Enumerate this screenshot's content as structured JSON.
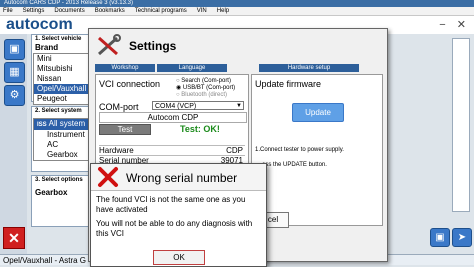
{
  "window": {
    "title": "Autocom CARS CDP - 2013 Release 3 (v3.13.3)",
    "logo": "autocom",
    "min_btn": "−",
    "close_btn": "✕"
  },
  "menu": [
    "File",
    "Settings",
    "Documents",
    "Bookmarks",
    "Technical programs",
    "VIN",
    "Help"
  ],
  "left_icons": [
    "car-icon",
    "truck-icon",
    "tools-icon"
  ],
  "left_panel": {
    "brand_section": {
      "title": "1. Select vehicle",
      "label": "Brand",
      "items": [
        "Mini",
        "Mitsubishi",
        "Nissan",
        "Opel/Vauxhall",
        "Peugeot"
      ],
      "selected": "Opel/Vauxhall"
    },
    "system_section": {
      "title": "2. Select system",
      "items": [
        "All system",
        "Instrument",
        "AC",
        "Gearbox"
      ],
      "item_tags": [
        "ISS",
        "",
        "",
        ""
      ],
      "selected": "All system"
    },
    "options_section": {
      "title": "3. Select options",
      "label": "Gearbox"
    }
  },
  "status_bar": "Opel/Vauxhall - Astra G - ...",
  "settings": {
    "title": "Settings",
    "tabs": [
      "Workshop",
      "Language",
      "Hardware setup"
    ],
    "vci_label": "VCI connection",
    "vci_options": [
      "Search (Com-port)",
      "USB/BT (Com-port)",
      "Bluetooth (direct)"
    ],
    "vci_selected": "USB/BT (Com-port)",
    "com_label": "COM-port",
    "com_value": "COM4 (VCP)",
    "cdp_name": "Autocom CDP",
    "test_btn": "Test",
    "test_result": "Test: OK!",
    "hw_rows": [
      [
        "Hardware",
        "CDP"
      ],
      [
        "Serial number",
        "39071"
      ]
    ],
    "firmware_title": "Update firmware",
    "update_btn": "Update",
    "instr1": "1.Connect tester to power supply.",
    "instr2": "ess the UPDATE button.",
    "cancel_btn": "cel"
  },
  "error_dialog": {
    "title": "Wrong serial number",
    "line1": "The found VCI is not the same one as you have activated",
    "line2": "You will not be able to do any diagnosis with this VCI",
    "ok": "OK"
  },
  "colors": {
    "titlebar": "#3b6ea5",
    "accent_blue": "#2b5fa8",
    "ok_green": "#1a8a1a",
    "error_red": "#d01010"
  }
}
